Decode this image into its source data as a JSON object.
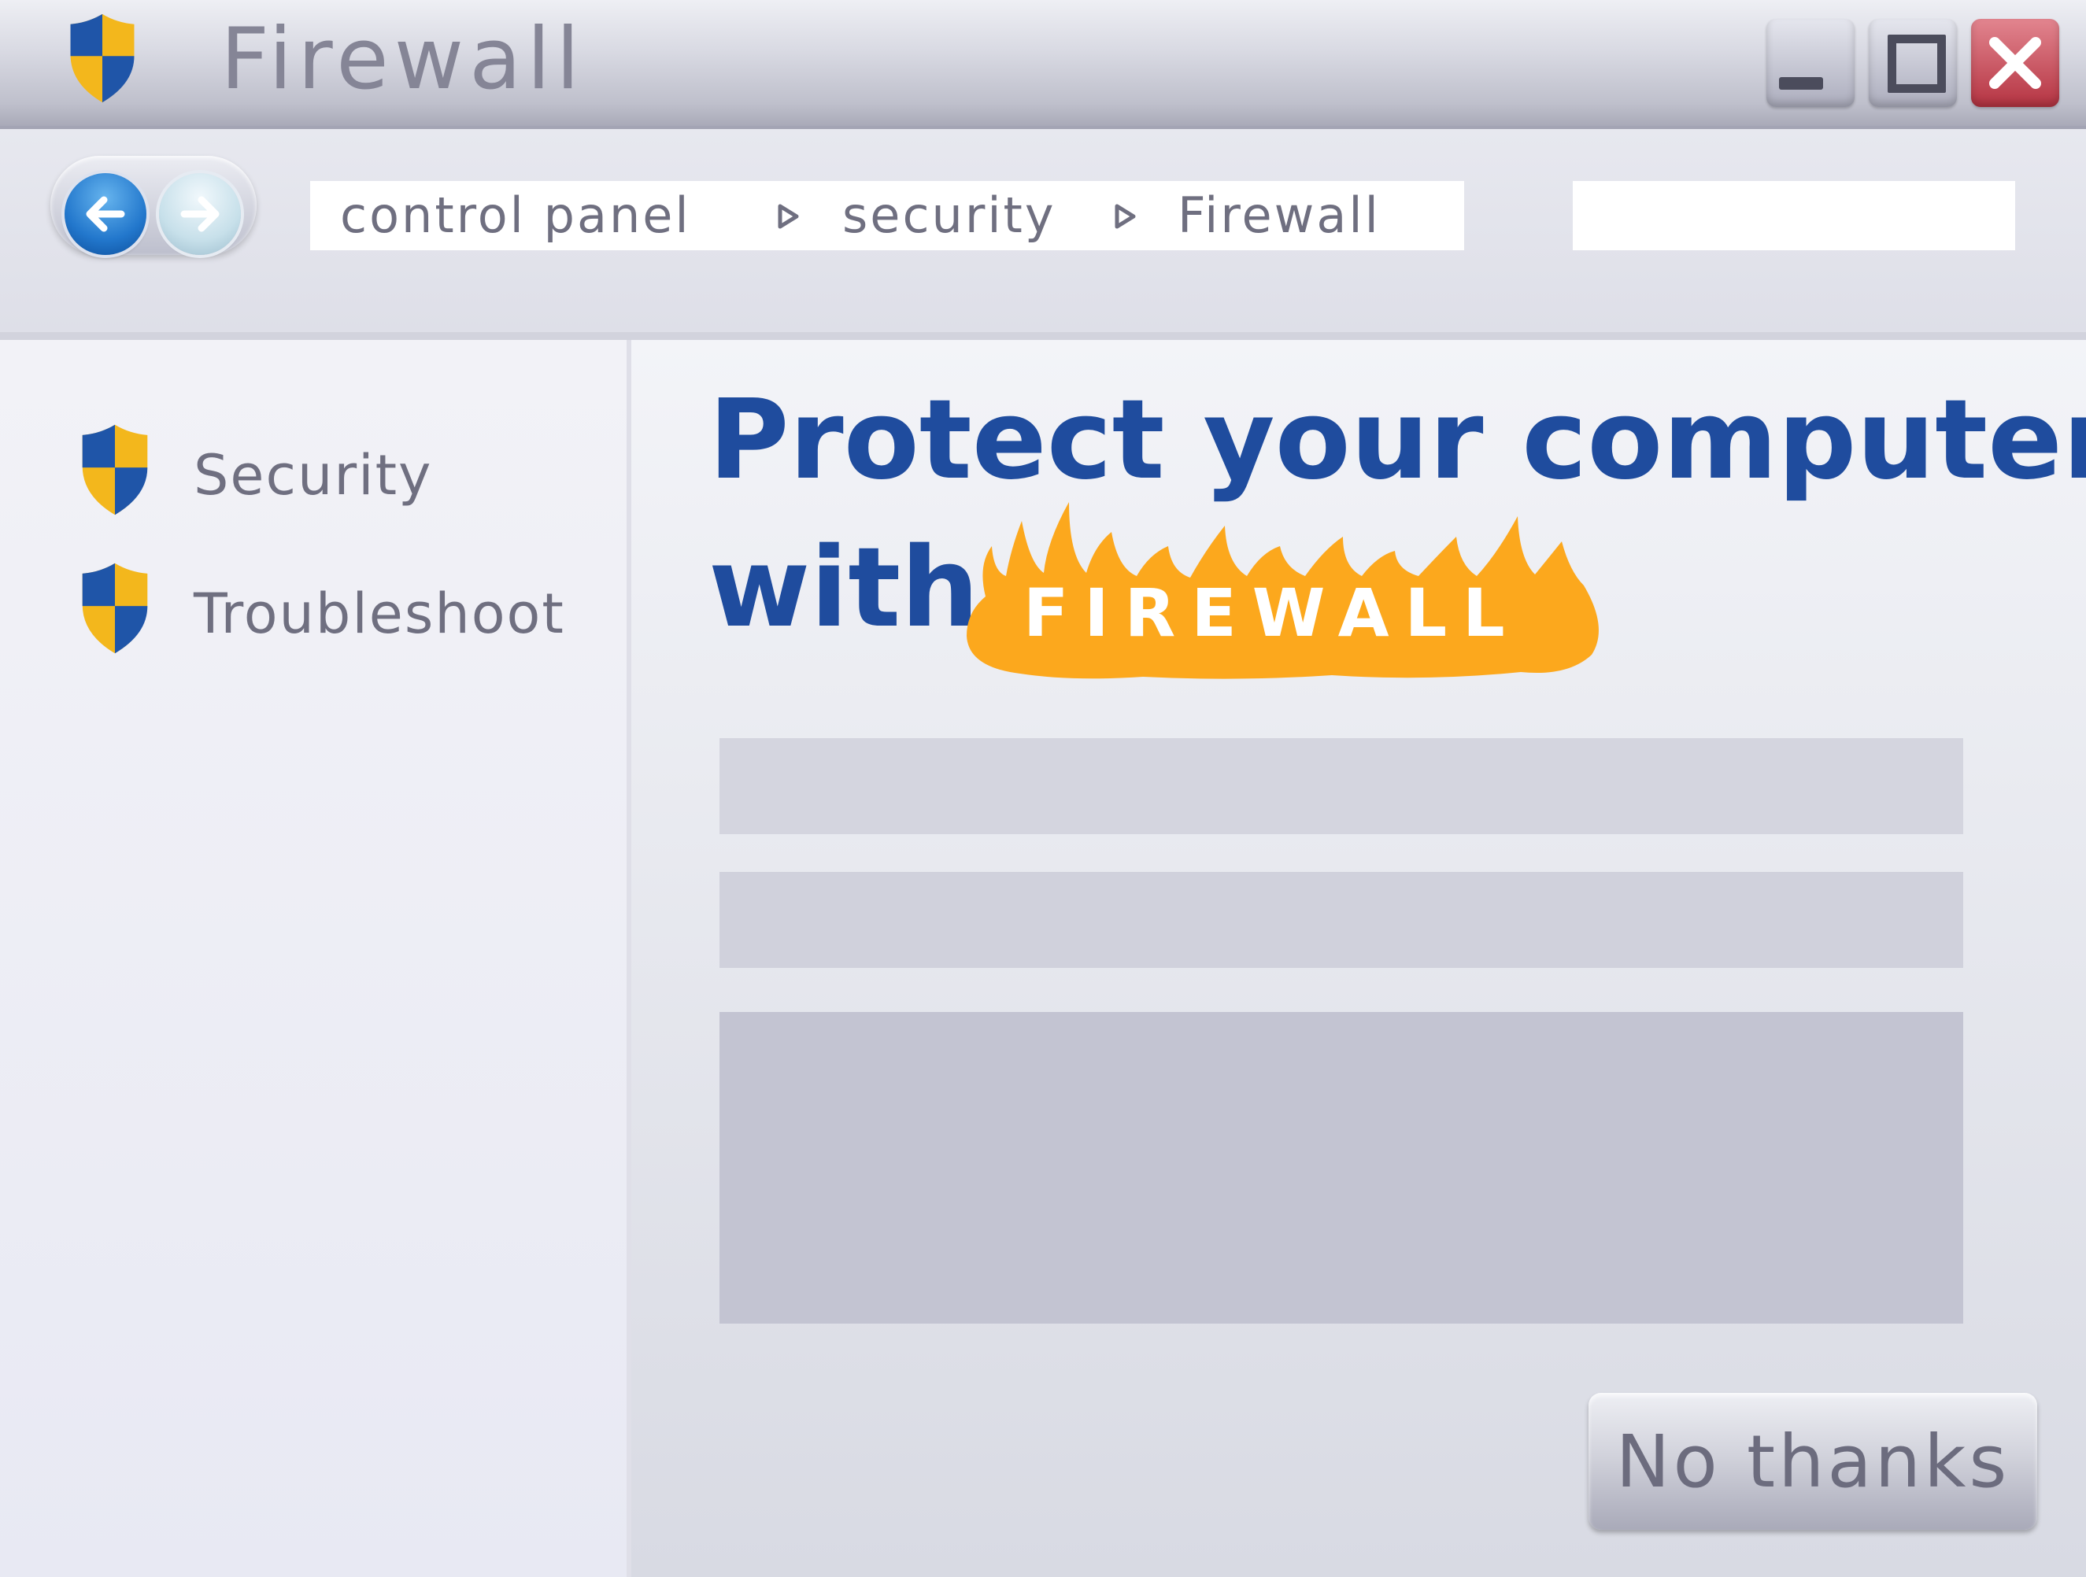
{
  "window": {
    "title": "Firewall",
    "icon": "shield-icon",
    "controls": [
      "minimize-icon",
      "maximize-icon",
      "close-icon"
    ]
  },
  "address_bar": {
    "back_icon": "arrow-left-icon",
    "forward_icon": "arrow-right-icon",
    "breadcrumb": [
      "control panel",
      "security",
      "Firewall"
    ],
    "separator_icon": "triangle-right-icon",
    "search_value": ""
  },
  "sidebar": {
    "items": [
      {
        "label": "Security",
        "icon": "shield-icon"
      },
      {
        "label": "Troubleshoot",
        "icon": "shield-icon"
      }
    ]
  },
  "main": {
    "headline_line1": "Protect your computer",
    "headline_line2": "with",
    "highlight": "FIREWALL",
    "no_thanks_label": "No thanks"
  },
  "colors": {
    "title_text": "#858596",
    "headline": "#1f4c9e",
    "flame": "#fca81d",
    "shield_blue": "#1f55a8",
    "shield_yellow": "#f3b71c",
    "close_button": "#c44050"
  }
}
